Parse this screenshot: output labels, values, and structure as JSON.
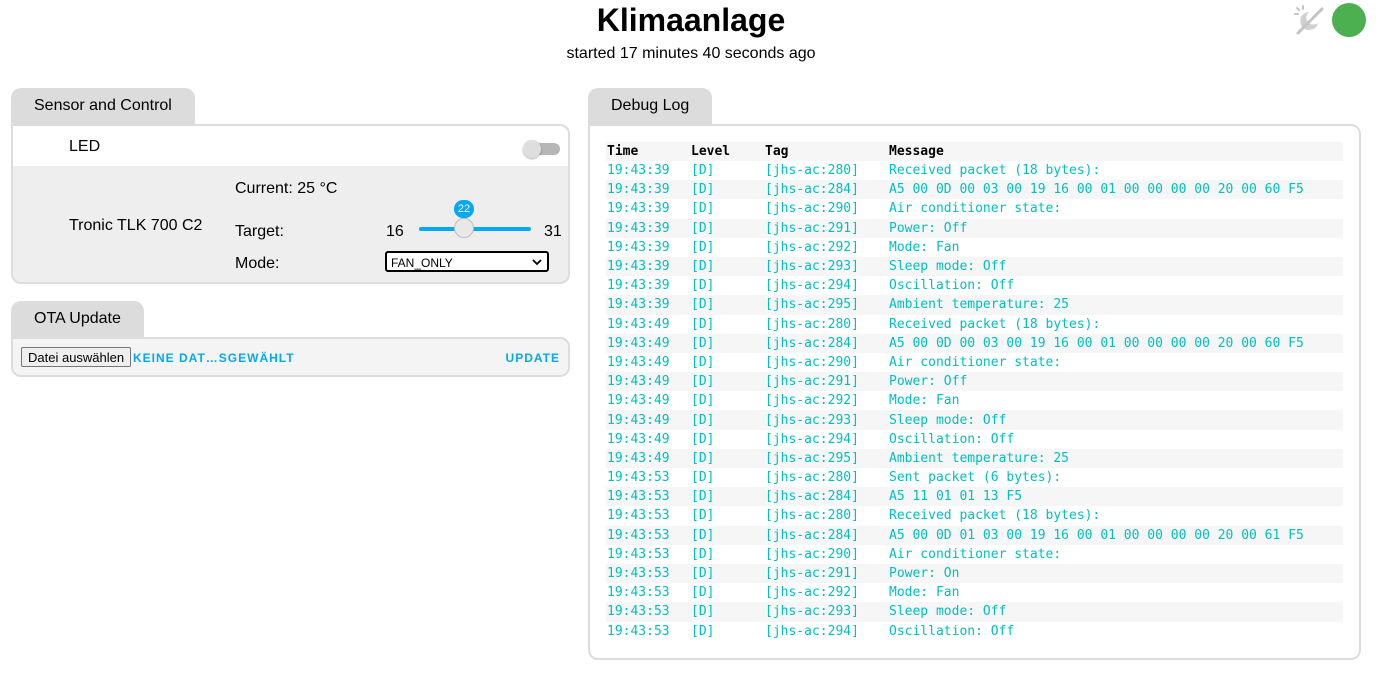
{
  "header": {
    "title": "Klimaanlage",
    "subtitle": "started 17 minutes 40 seconds ago",
    "status_color": "#4caf50",
    "scheme_icon": "weather-night-off-icon"
  },
  "colors": {
    "accent": "#03a9f4",
    "log_text": "#00c0c0",
    "tab_bg": "#dcdcdc"
  },
  "sensor_panel": {
    "tab_label": "Sensor and Control",
    "led": {
      "label": "LED",
      "state": "off"
    },
    "climate": {
      "name": "Tronic TLK 700 C2",
      "current_label": "Current: 25 °C",
      "target_label": "Target:",
      "target_min": "16",
      "target_max": "31",
      "target_value": "22",
      "mode_label": "Mode:",
      "mode_value": "FAN_ONLY"
    }
  },
  "ota_panel": {
    "tab_label": "OTA Update",
    "choose_file_label": "Datei auswählen",
    "file_name": "KEINE DAT…SGEWÄHLT",
    "update_label": "UPDATE"
  },
  "debug_log": {
    "tab_label": "Debug Log",
    "columns": [
      "Time",
      "Level",
      "Tag",
      "Message"
    ],
    "rows": [
      [
        "19:43:39",
        "[D]",
        "[jhs-ac:280]",
        "Received packet (18 bytes):"
      ],
      [
        "19:43:39",
        "[D]",
        "[jhs-ac:284]",
        "A5 00 0D 00 03 00 19 16 00 01 00 00 00 00 20 00 60 F5"
      ],
      [
        "19:43:39",
        "[D]",
        "[jhs-ac:290]",
        "Air conditioner state:"
      ],
      [
        "19:43:39",
        "[D]",
        "[jhs-ac:291]",
        "Power: Off"
      ],
      [
        "19:43:39",
        "[D]",
        "[jhs-ac:292]",
        "Mode: Fan"
      ],
      [
        "19:43:39",
        "[D]",
        "[jhs-ac:293]",
        "Sleep mode: Off"
      ],
      [
        "19:43:39",
        "[D]",
        "[jhs-ac:294]",
        "Oscillation: Off"
      ],
      [
        "19:43:39",
        "[D]",
        "[jhs-ac:295]",
        "Ambient temperature: 25"
      ],
      [
        "19:43:49",
        "[D]",
        "[jhs-ac:280]",
        "Received packet (18 bytes):"
      ],
      [
        "19:43:49",
        "[D]",
        "[jhs-ac:284]",
        "A5 00 0D 00 03 00 19 16 00 01 00 00 00 00 20 00 60 F5"
      ],
      [
        "19:43:49",
        "[D]",
        "[jhs-ac:290]",
        "Air conditioner state:"
      ],
      [
        "19:43:49",
        "[D]",
        "[jhs-ac:291]",
        "Power: Off"
      ],
      [
        "19:43:49",
        "[D]",
        "[jhs-ac:292]",
        "Mode: Fan"
      ],
      [
        "19:43:49",
        "[D]",
        "[jhs-ac:293]",
        "Sleep mode: Off"
      ],
      [
        "19:43:49",
        "[D]",
        "[jhs-ac:294]",
        "Oscillation: Off"
      ],
      [
        "19:43:49",
        "[D]",
        "[jhs-ac:295]",
        "Ambient temperature: 25"
      ],
      [
        "19:43:53",
        "[D]",
        "[jhs-ac:280]",
        "Sent packet (6 bytes):"
      ],
      [
        "19:43:53",
        "[D]",
        "[jhs-ac:284]",
        "A5 11 01 01 13 F5"
      ],
      [
        "19:43:53",
        "[D]",
        "[jhs-ac:280]",
        "Received packet (18 bytes):"
      ],
      [
        "19:43:53",
        "[D]",
        "[jhs-ac:284]",
        "A5 00 0D 01 03 00 19 16 00 01 00 00 00 00 20 00 61 F5"
      ],
      [
        "19:43:53",
        "[D]",
        "[jhs-ac:290]",
        "Air conditioner state:"
      ],
      [
        "19:43:53",
        "[D]",
        "[jhs-ac:291]",
        "Power: On"
      ],
      [
        "19:43:53",
        "[D]",
        "[jhs-ac:292]",
        "Mode: Fan"
      ],
      [
        "19:43:53",
        "[D]",
        "[jhs-ac:293]",
        "Sleep mode: Off"
      ],
      [
        "19:43:53",
        "[D]",
        "[jhs-ac:294]",
        "Oscillation: Off"
      ]
    ]
  }
}
